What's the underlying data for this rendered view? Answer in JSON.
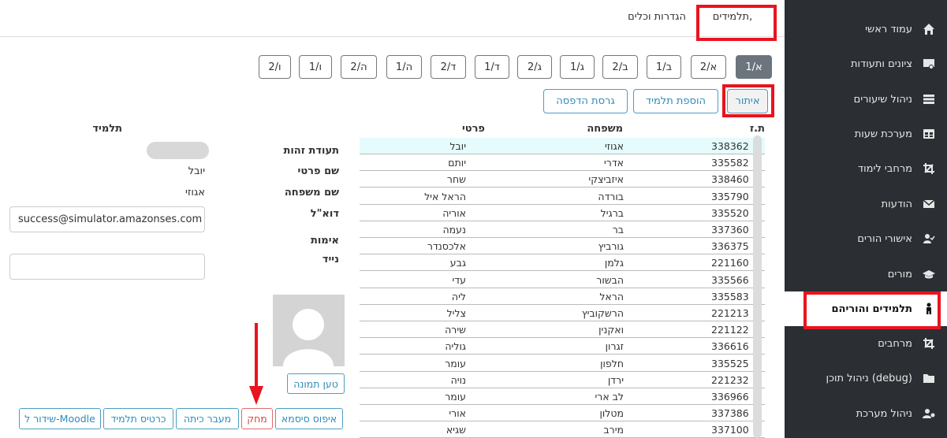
{
  "sidebar": {
    "items": [
      {
        "label": "עמוד ראשי",
        "icon": "home-icon"
      },
      {
        "label": "ציונים ותעודות",
        "icon": "certificate-icon"
      },
      {
        "label": "ניהול שיעורים",
        "icon": "list-icon"
      },
      {
        "label": "מערכת שעות",
        "icon": "table-icon"
      },
      {
        "label": "מרחבי לימוד",
        "icon": "crop-icon"
      },
      {
        "label": "הודעות",
        "icon": "envelope-icon"
      },
      {
        "label": "אישורי הורים",
        "icon": "user-check-icon"
      },
      {
        "label": "מורים",
        "icon": "graduation-cap-icon"
      },
      {
        "label": "תלמידים והוריהם",
        "icon": "child-icon"
      },
      {
        "label": "מרחבים",
        "icon": "crop-icon"
      },
      {
        "label": "ניהול תוכן (debug)",
        "icon": "folder-icon"
      },
      {
        "label": "ניהול מערכת",
        "icon": "users-cog-icon"
      }
    ],
    "active_index": 8
  },
  "tabs": {
    "students": "תלמידים,",
    "settings": "הגדרות וכלים"
  },
  "classes": [
    "א/1",
    "א/2",
    "ב/1",
    "ב/2",
    "ג/1",
    "ג/2",
    "ד/1",
    "ד/2",
    "ה/1",
    "ה/2",
    "ו/1",
    "ו/2"
  ],
  "active_class": "א/1",
  "actions": {
    "search": "איתור",
    "add_student": "הוספת תלמיד",
    "print_version": "גרסת הדפסה"
  },
  "table": {
    "headers": {
      "id": "ת.ז",
      "family": "משפחה",
      "first": "פרטי"
    },
    "rows": [
      {
        "id": "338362",
        "family": "אגוזי",
        "first": "יובל"
      },
      {
        "id": "335582",
        "family": "אדרי",
        "first": "יותם"
      },
      {
        "id": "338460",
        "family": "איזביצקי",
        "first": "שחר"
      },
      {
        "id": "335790",
        "family": "בורדה",
        "first": "הראל איל"
      },
      {
        "id": "335520",
        "family": "ברגיל",
        "first": "אוריה"
      },
      {
        "id": "337360",
        "family": "בר",
        "first": "נעמה"
      },
      {
        "id": "336375",
        "family": "גורביץ",
        "first": "אלכסנדר"
      },
      {
        "id": "221160",
        "family": "גלמן",
        "first": "גבע"
      },
      {
        "id": "335566",
        "family": "הבשור",
        "first": "עדי"
      },
      {
        "id": "335583",
        "family": "הראל",
        "first": "ליה"
      },
      {
        "id": "221213",
        "family": "הרשקוביץ",
        "first": "צליל"
      },
      {
        "id": "221122",
        "family": "ואקנין",
        "first": "שירה"
      },
      {
        "id": "336616",
        "family": "זגרון",
        "first": "גוליה"
      },
      {
        "id": "335525",
        "family": "חלפון",
        "first": "עומר"
      },
      {
        "id": "221232",
        "family": "ירדן",
        "first": "נויה"
      },
      {
        "id": "336966",
        "family": "לב ארי",
        "first": "עומר"
      },
      {
        "id": "337386",
        "family": "מטלון",
        "first": "אורי"
      },
      {
        "id": "337100",
        "family": "מירב",
        "first": "שגיא"
      }
    ]
  },
  "details": {
    "title": "תלמיד",
    "labels": {
      "id": "תעודת זהות",
      "first": "שם פרטי",
      "family": "שם משפחה",
      "email": "דוא\"ל",
      "verify": "אימות",
      "mobile": "נייד"
    },
    "values": {
      "first": "יובל",
      "family": "אגוזי",
      "email": "success@simulator.amazonses.com",
      "mobile": ""
    },
    "upload_photo": "טען תמונה"
  },
  "bottom_buttons": {
    "reset_password": "איפוס סיסמא",
    "delete": "מחק",
    "class_transfer": "מעבר כיתה",
    "student_card": "כרטיס תלמיד",
    "moodle_sync": "שידור ל-Moodle"
  },
  "colors": {
    "sidebar_bg": "#2b2f33",
    "highlight_red": "#e8141f",
    "accent_blue": "#2f8bb8",
    "active_class_bg": "#6c757d"
  }
}
